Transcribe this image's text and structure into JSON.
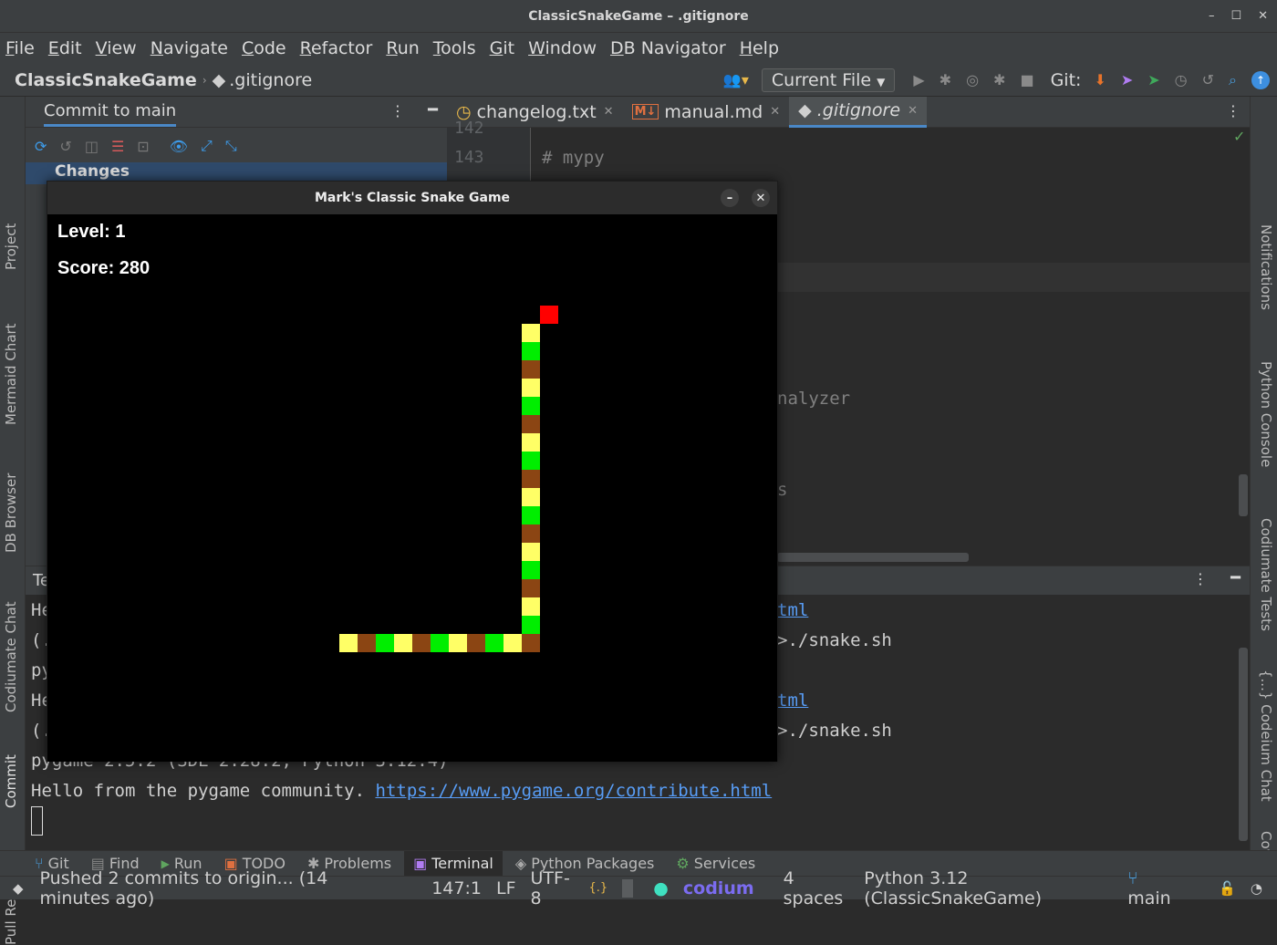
{
  "window": {
    "title": "ClassicSnakeGame – .gitignore",
    "controls": [
      "–",
      "☐",
      "✕"
    ]
  },
  "menu": [
    "File",
    "Edit",
    "View",
    "Navigate",
    "Code",
    "Refactor",
    "Run",
    "Tools",
    "Git",
    "Window",
    "DB Navigator",
    "Help"
  ],
  "nav": {
    "project": "ClassicSnakeGame",
    "file": ".gitignore",
    "run_config": "Current File",
    "git_label": "Git:"
  },
  "left_stripe": [
    "Project",
    "Mermaid Chart",
    "DB Browser",
    "Codiumate Chat",
    "Commit",
    "Pull Requests"
  ],
  "right_stripe": [
    "Notifications",
    "Python Console",
    "Codiumate Tests",
    "{...} Codeium Chat",
    "Coverage"
  ],
  "commit_panel": {
    "tab": "Commit to main",
    "changes": "Changes"
  },
  "editor": {
    "tabs": [
      {
        "label": "changelog.txt",
        "icon": "clock-icon"
      },
      {
        "label": "manual.md",
        "icon": "markdown-icon"
      },
      {
        "label": ".gitignore",
        "icon": "git-icon",
        "active": true
      }
    ],
    "line_142": "142",
    "line_143": "143",
    "code_143": "# mypy",
    "code_fragment_analyzer": "nalyzer",
    "code_fragment_s": "s"
  },
  "terminal": {
    "header_fragment": "Te",
    "lines": [
      {
        "left": "He",
        "right": "tml",
        "right_link": true
      },
      {
        "left": "(.",
        "right": ">./snake.sh",
        "right_link": false
      },
      {
        "left": "py",
        "right": "",
        "right_link": false
      },
      {
        "left": "He",
        "right": "tml",
        "right_link": true
      },
      {
        "left": "(.",
        "right": ">./snake.sh",
        "right_link": false
      }
    ],
    "line_pygame": "pygame 2.5.2 (SDL 2.28.2, Python 3.12.4)",
    "line_hello_text": "Hello from the pygame community. ",
    "line_hello_link": "https://www.pygame.org/contribute.html"
  },
  "bottom_tools": [
    {
      "label": "Git",
      "icon": "git-branch-icon"
    },
    {
      "label": "Find",
      "icon": "find-icon"
    },
    {
      "label": "Run",
      "icon": "play-icon"
    },
    {
      "label": "TODO",
      "icon": "todo-icon"
    },
    {
      "label": "Problems",
      "icon": "bug-icon"
    },
    {
      "label": "Terminal",
      "icon": "terminal-icon",
      "active": true
    },
    {
      "label": "Python Packages",
      "icon": "layers-icon"
    },
    {
      "label": "Services",
      "icon": "gear-icon"
    }
  ],
  "status": {
    "message": "Pushed 2 commits to origin... (14 minutes ago)",
    "position": "147:1",
    "line_sep": "LF",
    "encoding": "UTF-8",
    "codium": "codium",
    "indent": "4 spaces",
    "interpreter": "Python 3.12 (ClassicSnakeGame)",
    "branch": "main"
  },
  "snake_window": {
    "title": "Mark's Classic Snake Game",
    "level_label": "Level: 1",
    "score_label": "Score: 280",
    "colors": {
      "yellow": "#ffff66",
      "green": "#00ee00",
      "brown": "#8b4513",
      "food": "#ff0000"
    },
    "food": {
      "col": 27,
      "row": 5
    },
    "snake": [
      {
        "col": 26,
        "row": 6,
        "c": "yellow"
      },
      {
        "col": 26,
        "row": 7,
        "c": "green"
      },
      {
        "col": 26,
        "row": 8,
        "c": "brown"
      },
      {
        "col": 26,
        "row": 9,
        "c": "yellow"
      },
      {
        "col": 26,
        "row": 10,
        "c": "green"
      },
      {
        "col": 26,
        "row": 11,
        "c": "brown"
      },
      {
        "col": 26,
        "row": 12,
        "c": "yellow"
      },
      {
        "col": 26,
        "row": 13,
        "c": "green"
      },
      {
        "col": 26,
        "row": 14,
        "c": "brown"
      },
      {
        "col": 26,
        "row": 15,
        "c": "yellow"
      },
      {
        "col": 26,
        "row": 16,
        "c": "green"
      },
      {
        "col": 26,
        "row": 17,
        "c": "brown"
      },
      {
        "col": 26,
        "row": 18,
        "c": "yellow"
      },
      {
        "col": 26,
        "row": 19,
        "c": "green"
      },
      {
        "col": 26,
        "row": 20,
        "c": "brown"
      },
      {
        "col": 26,
        "row": 21,
        "c": "yellow"
      },
      {
        "col": 26,
        "row": 22,
        "c": "green"
      },
      {
        "col": 26,
        "row": 23,
        "c": "brown"
      },
      {
        "col": 25,
        "row": 23,
        "c": "yellow"
      },
      {
        "col": 24,
        "row": 23,
        "c": "green"
      },
      {
        "col": 23,
        "row": 23,
        "c": "brown"
      },
      {
        "col": 22,
        "row": 23,
        "c": "yellow"
      },
      {
        "col": 21,
        "row": 23,
        "c": "green"
      },
      {
        "col": 20,
        "row": 23,
        "c": "brown"
      },
      {
        "col": 19,
        "row": 23,
        "c": "yellow"
      },
      {
        "col": 18,
        "row": 23,
        "c": "green"
      },
      {
        "col": 17,
        "row": 23,
        "c": "brown"
      },
      {
        "col": 16,
        "row": 23,
        "c": "yellow"
      }
    ]
  }
}
